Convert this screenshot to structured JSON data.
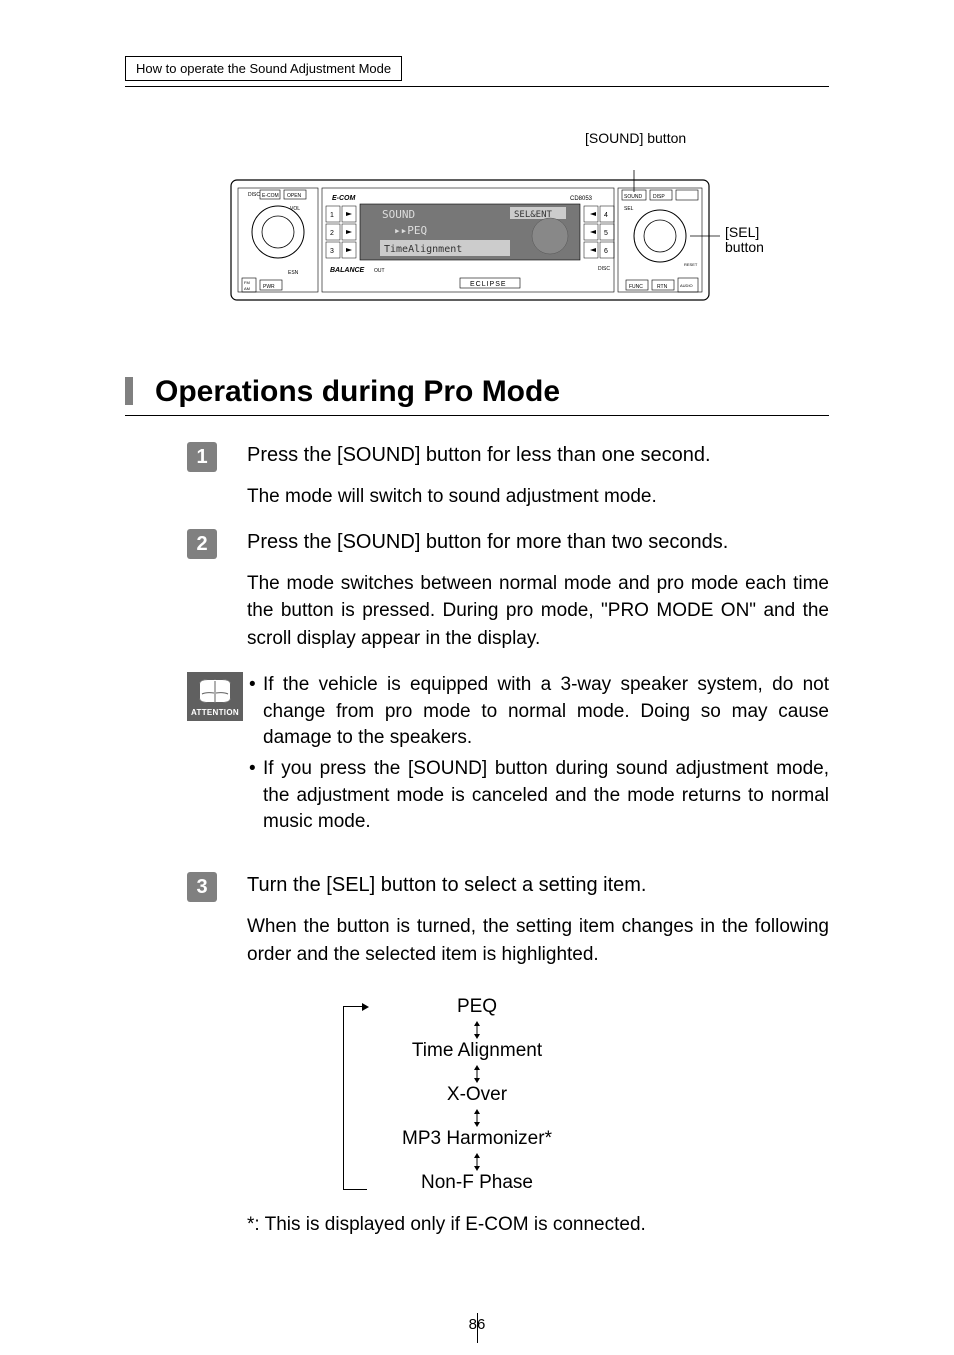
{
  "breadcrumb": "How to operate the Sound Adjustment Mode",
  "diagram": {
    "label_top": "[SOUND] button",
    "label_right_1": "[SEL]",
    "label_right_2": "button",
    "display_line1": "SOUND",
    "display_line2": "PEQ",
    "display_line3": "TimeAlignment",
    "display_right": "SEL&ENT",
    "brand": "ECLIPSE",
    "model": "CD8053",
    "balance": "BALANCE"
  },
  "section_title": "Operations during Pro Mode",
  "steps": {
    "s1": {
      "num": "1",
      "head": "Press the [SOUND] button for less than one second.",
      "body": "The mode will switch to sound adjustment mode."
    },
    "s2": {
      "num": "2",
      "head": "Press the [SOUND] button for more than two seconds.",
      "body": "The mode switches between normal mode and pro mode each time the button is pressed. During pro mode, \"PRO MODE ON\" and the scroll display appear in the display."
    },
    "s3": {
      "num": "3",
      "head": "Turn the [SEL] button to select a setting item.",
      "body": "When the button is turned, the setting item changes in the following order and the selected item is highlighted."
    }
  },
  "attention": {
    "label": "ATTENTION",
    "item1": "If the vehicle is equipped with a 3-way speaker system, do not change from pro mode to normal  mode. Doing so may cause damage to the speakers.",
    "item2": "If you press the [SOUND] button during sound adjustment mode, the adjustment mode is canceled and the mode returns to normal music mode."
  },
  "flow": {
    "i1": "PEQ",
    "i2": "Time Alignment",
    "i3": "X-Over",
    "i4": "MP3 Harmonizer*",
    "i5": "Non-F Phase"
  },
  "footnote": "*: This is displayed only if E-COM is connected.",
  "page_number": "86"
}
